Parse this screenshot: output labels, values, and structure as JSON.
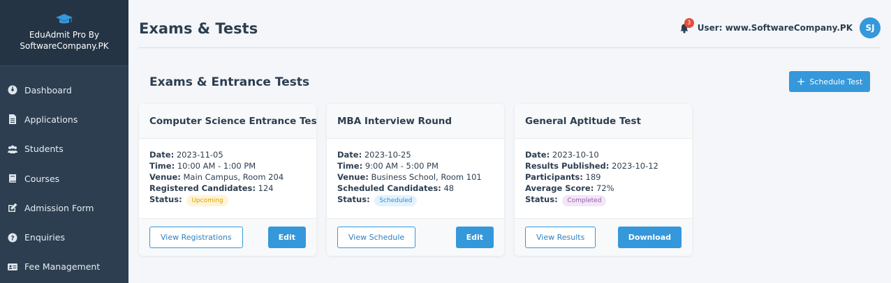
{
  "brand": {
    "line1": "EduAdmit Pro By",
    "line2": "SoftwareCompany.PK",
    "icon": "graduation-cap-icon"
  },
  "sidebar": {
    "items": [
      {
        "label": "Dashboard",
        "icon": "dashboard-icon"
      },
      {
        "label": "Applications",
        "icon": "file-icon"
      },
      {
        "label": "Students",
        "icon": "users-icon"
      },
      {
        "label": "Courses",
        "icon": "book-icon"
      },
      {
        "label": "Admission Form",
        "icon": "edit-icon"
      },
      {
        "label": "Enquiries",
        "icon": "question-icon"
      },
      {
        "label": "Fee Management",
        "icon": "id-card-icon"
      }
    ]
  },
  "header": {
    "title": "Exams & Tests",
    "notification_count": "3",
    "user_label": "User: www.SoftwareCompany.PK",
    "avatar_initials": "SJ"
  },
  "section": {
    "title": "Exams & Entrance Tests",
    "schedule_button": "Schedule Test"
  },
  "cards": [
    {
      "title": "Computer Science Entrance Test",
      "rows": [
        {
          "label": "Date:",
          "value": "2023-11-05"
        },
        {
          "label": "Time:",
          "value": "10:00 AM - 1:00 PM"
        },
        {
          "label": "Venue:",
          "value": "Main Campus, Room 204"
        },
        {
          "label": "Registered Candidates:",
          "value": "124"
        }
      ],
      "status_label": "Status:",
      "status": "Upcoming",
      "primary_action": "View Registrations",
      "secondary_action": "Edit"
    },
    {
      "title": "MBA Interview Round",
      "rows": [
        {
          "label": "Date:",
          "value": "2023-10-25"
        },
        {
          "label": "Time:",
          "value": "9:00 AM - 5:00 PM"
        },
        {
          "label": "Venue:",
          "value": "Business School, Room 101"
        },
        {
          "label": "Scheduled Candidates:",
          "value": "48"
        }
      ],
      "status_label": "Status:",
      "status": "Scheduled",
      "primary_action": "View Schedule",
      "secondary_action": "Edit"
    },
    {
      "title": "General Aptitude Test",
      "rows": [
        {
          "label": "Date:",
          "value": "2023-10-10"
        },
        {
          "label": "Results Published:",
          "value": "2023-10-12"
        },
        {
          "label": "Participants:",
          "value": "189"
        },
        {
          "label": "Average Score:",
          "value": "72%"
        }
      ],
      "status_label": "Status:",
      "status": "Completed",
      "primary_action": "View Results",
      "secondary_action": "Download"
    }
  ],
  "colors": {
    "sidebar_bg": "#2c3e50",
    "accent": "#3498db",
    "badge": "#e74c3c",
    "upcoming": "#e0a100",
    "scheduled": "#2f8ed0",
    "completed": "#9b59b6"
  }
}
